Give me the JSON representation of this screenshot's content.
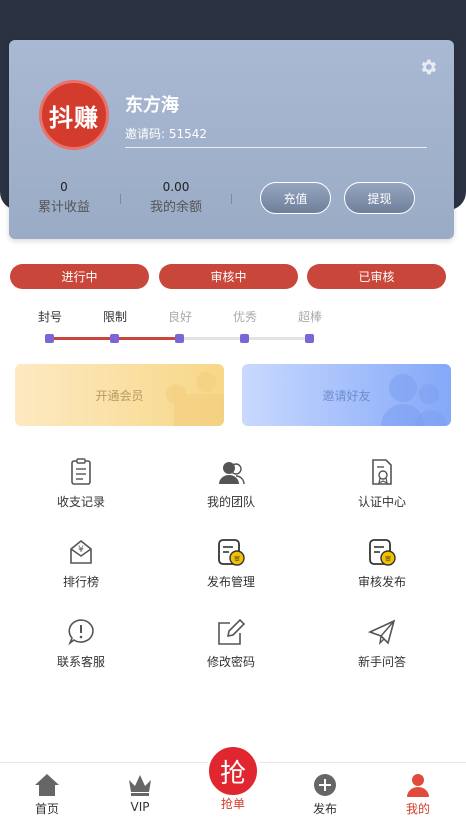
{
  "profile": {
    "avatar_text": "抖赚",
    "username": "东方海",
    "invite_code_text": "邀请码: 51542",
    "stats": [
      {
        "value": "0",
        "label": "累计收益"
      },
      {
        "value": "0.00",
        "label": "我的余额"
      }
    ],
    "recharge_label": "充值",
    "withdraw_label": "提现"
  },
  "status_tabs": [
    "进行中",
    "审核中",
    "已审核"
  ],
  "levels": {
    "labels": [
      "封号",
      "限制",
      "良好",
      "优秀",
      "超棒"
    ],
    "current_index": 2,
    "colors": {
      "active_text": "#333333",
      "inactive_text": "#aaaaaa",
      "progress": "#c9463a",
      "dot": "#7b66d7"
    }
  },
  "banners": {
    "vip_label": "开通会员",
    "invite_label": "邀请好友"
  },
  "menu": [
    {
      "label": "收支记录",
      "icon": "records-icon"
    },
    {
      "label": "我的团队",
      "icon": "team-icon"
    },
    {
      "label": "认证中心",
      "icon": "certification-icon"
    },
    {
      "label": "排行榜",
      "icon": "ranking-icon"
    },
    {
      "label": "发布管理",
      "icon": "publish-manage-icon"
    },
    {
      "label": "审核发布",
      "icon": "review-publish-icon"
    },
    {
      "label": "联系客服",
      "icon": "customer-service-icon"
    },
    {
      "label": "修改密码",
      "icon": "edit-password-icon"
    },
    {
      "label": "新手问答",
      "icon": "faq-icon"
    }
  ],
  "tabbar": {
    "items": [
      {
        "label": "首页",
        "icon": "home-icon"
      },
      {
        "label": "VIP",
        "icon": "crown-icon"
      },
      {
        "label": "发布",
        "icon": "plus-circle-icon"
      },
      {
        "label": "我的",
        "icon": "user-icon"
      }
    ],
    "center_label": "抢单",
    "center_icon_text": "抢",
    "active": "我的",
    "accent": "#d33b2c"
  }
}
